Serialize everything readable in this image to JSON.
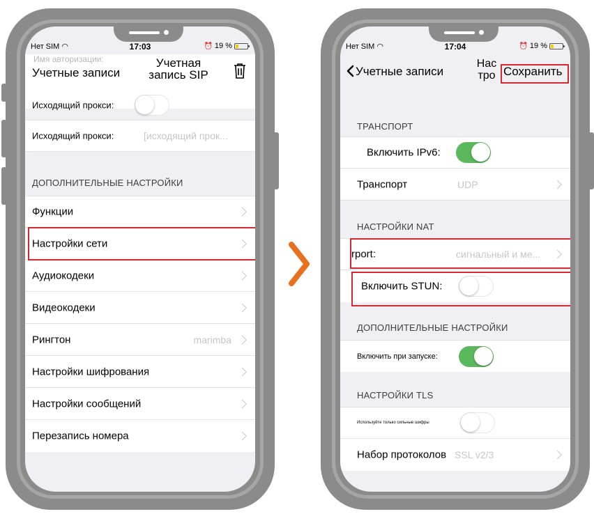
{
  "colors": {
    "accent_red": "#d7262d",
    "toggle_on": "#5cb85c",
    "arrow_orange": "#e8711f",
    "frame_gray": "#8b8b8b"
  },
  "left_phone": {
    "status": {
      "carrier": "Нет SIM",
      "time": "17:03",
      "battery": "19 %"
    },
    "nav": {
      "back_label": "Учетные записи",
      "title": "Учетная запись SIP",
      "title_line1": "Учетная",
      "title_line2": "запись SIP",
      "trash_icon": "trash-icon",
      "ghost_text": "Имя авторизации:"
    },
    "rows_top": [
      {
        "label": "Исходящий прокси:",
        "toggle": "off"
      },
      {
        "label": "Исходящий прокси:",
        "placeholder": "[исходящий прок..."
      }
    ],
    "advanced_header": "ДОПОЛНИТЕЛЬНЫЕ НАСТРОЙКИ",
    "advanced_items": [
      {
        "label": "Функции"
      },
      {
        "label": "Настройки сети"
      },
      {
        "label": "Аудиокодеки"
      },
      {
        "label": "Видеокодеки"
      },
      {
        "label": "Рингтон",
        "value": "marimba"
      },
      {
        "label": "Настройки шифрования"
      },
      {
        "label": "Настройки сообщений"
      },
      {
        "label": "Перезапись номера"
      }
    ]
  },
  "right_phone": {
    "status": {
      "carrier": "Нет SIM",
      "time": "17:04",
      "battery": "19 %"
    },
    "nav": {
      "back_label": "Учетные записи",
      "title_line1": "Нас",
      "title_line2": "тро",
      "save_label": "Сохранить"
    },
    "transport_header": "ТРАНСПОРТ",
    "transport_rows": [
      {
        "label": "Включить IPv6:",
        "toggle": "on"
      },
      {
        "label": "Транспорт",
        "value": "UDP"
      }
    ],
    "nat_header": "НАСТРОЙКИ NAT",
    "nat_rows": [
      {
        "label": "rport:",
        "value": "сигнальный и ме..."
      },
      {
        "label": "Включить STUN:",
        "toggle": "off"
      }
    ],
    "advanced_header": "ДОПОЛНИТЕЛЬНЫЕ НАСТРОЙКИ",
    "advanced_rows": [
      {
        "label": "Включить при запуске:",
        "toggle": "on"
      }
    ],
    "tls_header": "НАСТРОЙКИ TLS",
    "tls_rows": [
      {
        "label": "Используйте только сильные шифры",
        "toggle": "off"
      },
      {
        "label": "Набор протоколов",
        "value": "SSL v2/3"
      }
    ]
  }
}
